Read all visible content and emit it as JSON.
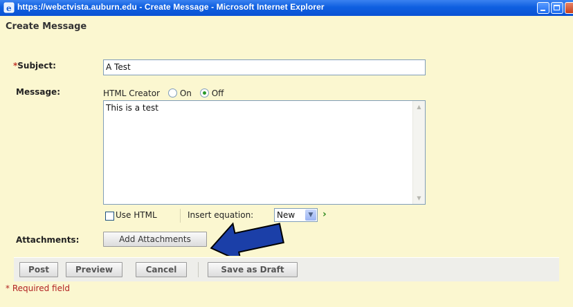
{
  "window": {
    "title": "https://webctvista.auburn.edu - Create Message - Microsoft Internet Explorer"
  },
  "form": {
    "heading": "Create Message",
    "subject_label": "Subject:",
    "required_star": "*",
    "subject_value": "A Test",
    "message_label": "Message:",
    "html_creator_label": "HTML Creator",
    "html_creator_on": "On",
    "html_creator_off": "Off",
    "html_creator_selected": "Off",
    "message_value": "This is a test",
    "use_html_label": "Use HTML",
    "insert_equation_label": "Insert equation:",
    "equation_select_value": "New",
    "attachments_label": "Attachments:",
    "add_attachments_label": "Add Attachments"
  },
  "actions": {
    "post": "Post",
    "preview": "Preview",
    "cancel": "Cancel",
    "save_draft": "Save as Draft"
  },
  "footer": {
    "required_note": "* Required field"
  },
  "colors": {
    "page_bg": "#fbf7d0",
    "titlebar_blue": "#0a52d4",
    "required_red": "#b22222",
    "pointer_arrow": "#1b3fa8"
  }
}
